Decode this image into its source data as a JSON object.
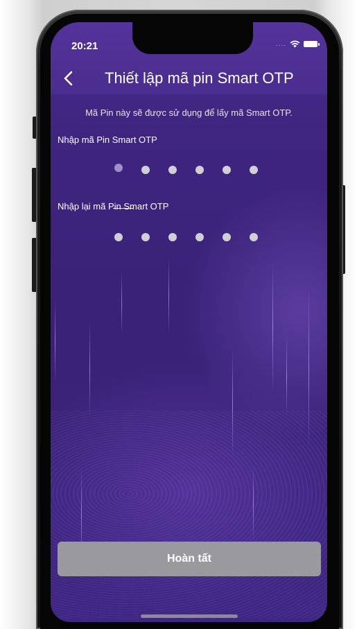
{
  "status_bar": {
    "time": "20:21",
    "signal_dots": "....",
    "wifi_icon": "wifi-icon",
    "battery_icon": "battery-icon"
  },
  "header": {
    "back_icon": "chevron-left-icon",
    "title": "Thiết lập mã pin Smart OTP"
  },
  "description": "Mã Pin này sẽ được sử dụng để lấy mã Smart OTP.",
  "pin_entry": {
    "label": "Nhập mã Pin Smart OTP",
    "digits": 6,
    "active_index": 0
  },
  "pin_confirm": {
    "label": "Nhập lại mã Pin Smart OTP",
    "digits": 6
  },
  "done_button": {
    "label": "Hoàn tất"
  },
  "colors": {
    "background": "#3b2379",
    "header": "#4a2d8e",
    "button": "#9a9a9e",
    "pin_dot": "#cfcfd6",
    "pin_dot_active": "#9f8fc8"
  }
}
